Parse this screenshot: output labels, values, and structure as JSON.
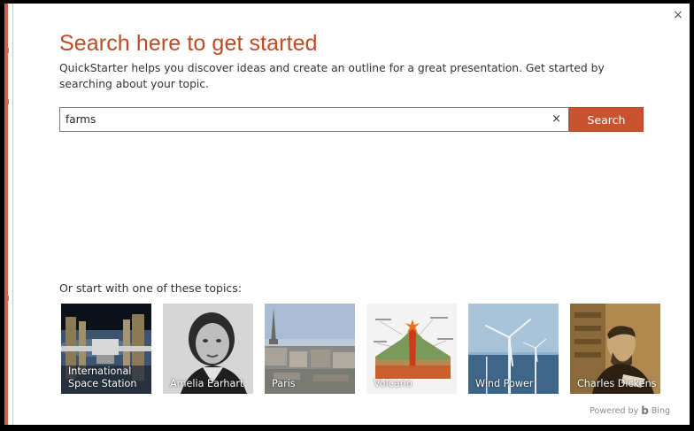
{
  "dialog": {
    "close": "×",
    "title": "Search here to get started",
    "description": "QuickStarter helps you discover ideas and create an outline for a great presentation. Get started by searching about your topic."
  },
  "search": {
    "value": "farms",
    "clear": "×",
    "button_label": "Search"
  },
  "topics": {
    "label": "Or start with one of these topics:",
    "items": [
      {
        "name": "International Space Station",
        "icon": "space-station-photo"
      },
      {
        "name": "Amelia Earhart",
        "icon": "portrait-photo"
      },
      {
        "name": "Paris",
        "icon": "paris-skyline-photo"
      },
      {
        "name": "Volcano",
        "icon": "volcano-diagram"
      },
      {
        "name": "Wind Power",
        "icon": "wind-turbine-photo"
      },
      {
        "name": "Charles Dickens",
        "icon": "portrait-photo"
      }
    ]
  },
  "footer": {
    "powered_by": "Powered by",
    "brand": "Bing",
    "brand_icon": "bing-logo-icon"
  },
  "colors": {
    "accent": "#c04a24",
    "button": "#c9532f"
  }
}
